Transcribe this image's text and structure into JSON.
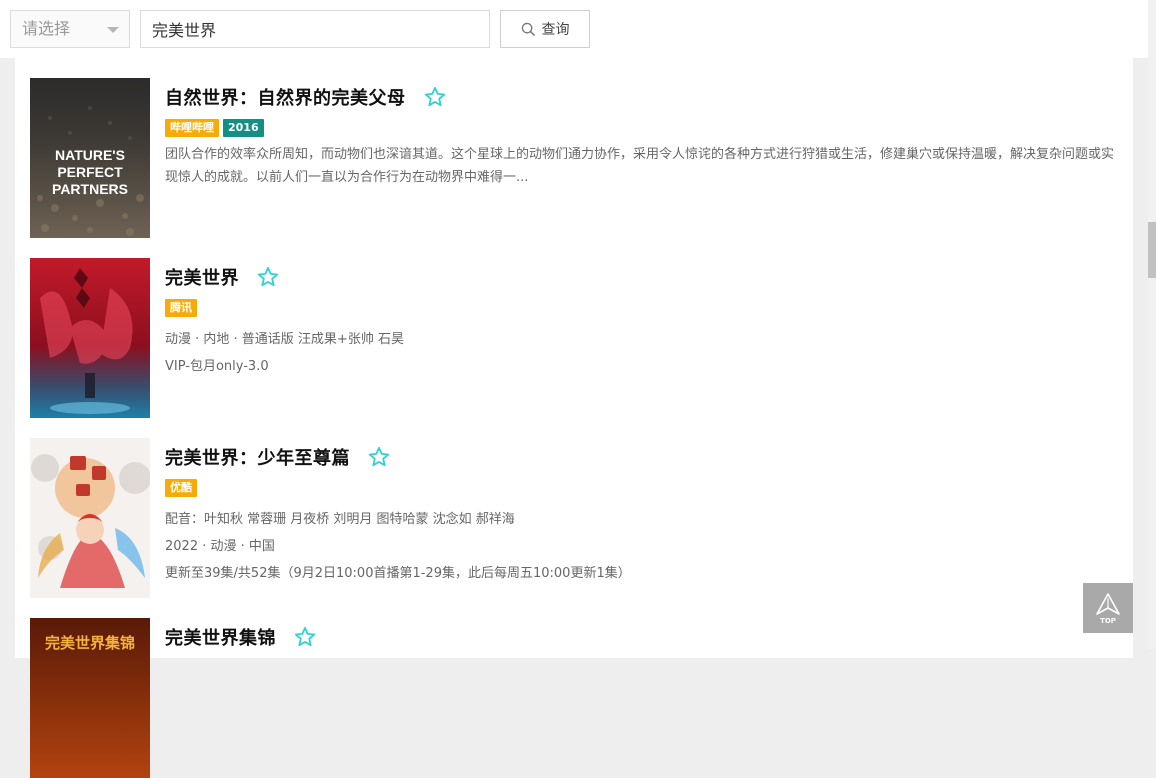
{
  "search": {
    "select_placeholder": "请选择",
    "query_value": "完美世界",
    "button_label": "查询"
  },
  "results": [
    {
      "title": "自然世界：自然界的完美父母",
      "tags": [
        {
          "label": "哔哩哔哩",
          "color": "#f5ac08"
        },
        {
          "label": "2016",
          "color": "#138f85"
        }
      ],
      "poster_text": [
        "NATURE'S",
        "PERFECT",
        "PARTNERS"
      ],
      "description": "团队合作的效率众所周知，而动物们也深谙其道。这个星球上的动物们通力协作，采用令人惊诧的各种方式进行狩猎或生活，修建巢穴或保持温暖，解决复杂问题或实现惊人的成就。以前人们一直以为合作行为在动物界中难得一..."
    },
    {
      "title": "完美世界",
      "tags": [
        {
          "label": "腾讯",
          "color": "#f5ac08"
        }
      ],
      "meta": [
        "动漫 · 内地 · 普通话版 汪成果+张帅 石昊",
        "VIP-包月only-3.0"
      ]
    },
    {
      "title": "完美世界：少年至尊篇",
      "tags": [
        {
          "label": "优酷",
          "color": "#f5ac08"
        }
      ],
      "meta": [
        "配音：叶知秋 常蓉珊 月夜桥 刘明月 图特哈蒙 沈念如 郝祥海",
        "2022 · 动漫 · 中国",
        "更新至39集/共52集（9月2日10:00首播第1-29集，此后每周五10:00更新1集）"
      ]
    },
    {
      "title": "完美世界集锦",
      "tags": [],
      "poster_text": [
        "完美世界集锦"
      ]
    }
  ],
  "back_to_top": {
    "label": "TOP"
  },
  "colors": {
    "star": "#2ed3d3",
    "tag_orange": "#f5ac08",
    "tag_teal": "#138f85"
  }
}
